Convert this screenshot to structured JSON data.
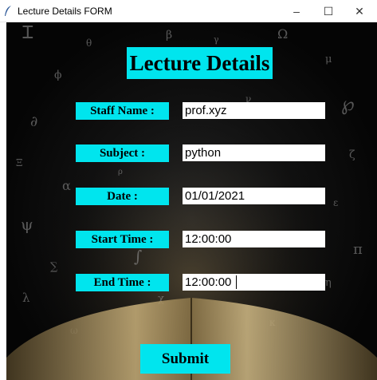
{
  "window": {
    "title": "Lecture Details FORM",
    "minimize_glyph": "–",
    "maximize_glyph": "☐",
    "close_glyph": "✕"
  },
  "form": {
    "heading": "Lecture Details",
    "fields": [
      {
        "label": "Staff Name :",
        "value": "prof.xyz"
      },
      {
        "label": "Subject :",
        "value": "python"
      },
      {
        "label": "Date :",
        "value": "01/01/2021"
      },
      {
        "label": "Start Time :",
        "value": "12:00:00"
      },
      {
        "label": "End Time :",
        "value": "12:00:00"
      }
    ],
    "submit_label": "Submit"
  },
  "colors": {
    "accent": "#00e5ee",
    "background": "#0b0b0b",
    "book_page": "#b9a06a"
  }
}
